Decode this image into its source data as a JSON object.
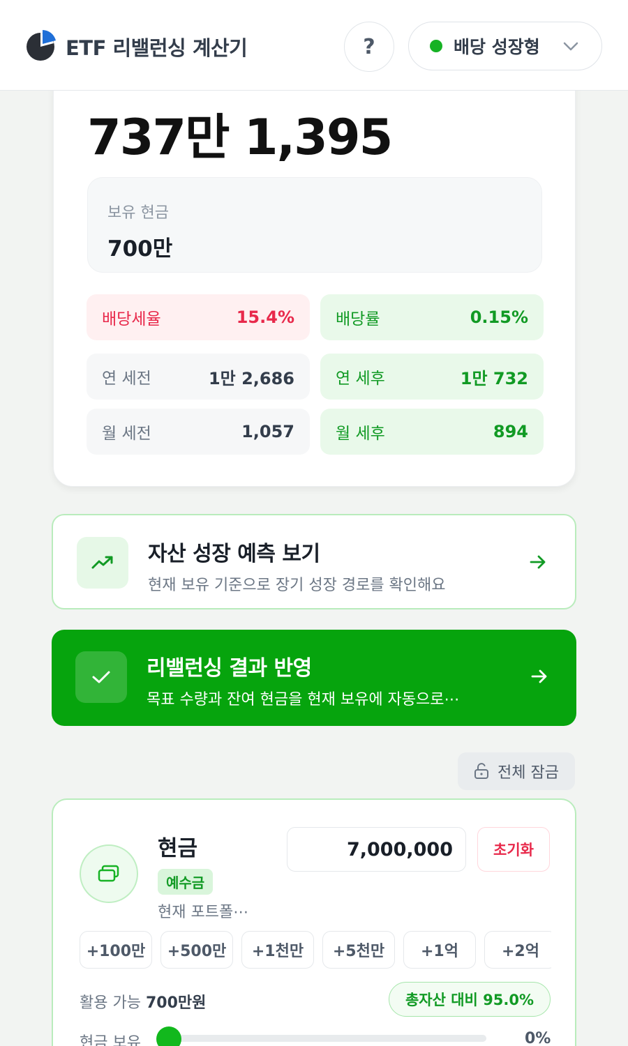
{
  "header": {
    "app_title": "ETF 리밸런싱 계산기",
    "help_label": "?",
    "profile_label": "배당 성장형"
  },
  "summary": {
    "total_amount": "737만 1,395",
    "cash_label": "보유 현금",
    "cash_value": "700만",
    "stats": [
      {
        "label": "배당세율",
        "value": "15.4%"
      },
      {
        "label": "배당률",
        "value": "0.15%"
      },
      {
        "label": "연 세전",
        "value": "1만 2,686"
      },
      {
        "label": "연 세후",
        "value": "1만 732"
      },
      {
        "label": "월 세전",
        "value": "1,057"
      },
      {
        "label": "월 세후",
        "value": "894"
      }
    ]
  },
  "actions": {
    "growth": {
      "title": "자산 성장 예측 보기",
      "subtitle": "현재 보유 기준으로 장기 성장 경로를 확인해요"
    },
    "apply": {
      "title": "리밸런싱 결과 반영",
      "subtitle": "목표 수량과 잔여 현금을 현재 보유에 자동으로⋯"
    }
  },
  "lock_all_label": "전체 잠금",
  "cash_card": {
    "name": "현금",
    "tag": "예수금",
    "description": "현재 포트폴⋯",
    "amount_value": "7,000,000",
    "reset_label": "초기화",
    "quick_add": [
      "+100만",
      "+500만",
      "+1천만",
      "+5천만",
      "+1억",
      "+2억"
    ],
    "available_prefix": "활용 가능",
    "available_value": "700만원",
    "ratio_label": "총자산 대비 95.0%",
    "hold_label": "현금 보유",
    "hold_percent": 0,
    "hold_value": "0%"
  },
  "colors": {
    "brand_green": "#06a40d",
    "negative_red": "#e8294b",
    "positive_green": "#119a24"
  }
}
